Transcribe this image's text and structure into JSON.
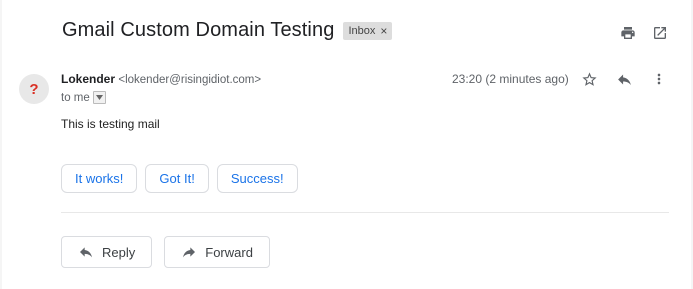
{
  "thread": {
    "subject": "Gmail Custom Domain Testing",
    "label": "Inbox",
    "label_remove": "×"
  },
  "toolbar": {
    "icons": [
      "print-icon",
      "open-in-new-window-icon"
    ]
  },
  "message": {
    "avatar_glyph": "?",
    "sender_name": "Lokender",
    "sender_email": "<lokender@risingidiot.com>",
    "recipient": "to me",
    "time": "23:20 (2 minutes ago)",
    "body": "This is testing mail",
    "icons": [
      "star-icon",
      "reply-icon",
      "more-vert-icon"
    ]
  },
  "smart_replies": [
    "It works!",
    "Got It!",
    "Success!"
  ],
  "actions": {
    "reply_label": "Reply",
    "forward_label": "Forward"
  },
  "colors": {
    "link_blue": "#1a73e8",
    "avatar_q": "#d93025",
    "border": "#dadce0"
  }
}
